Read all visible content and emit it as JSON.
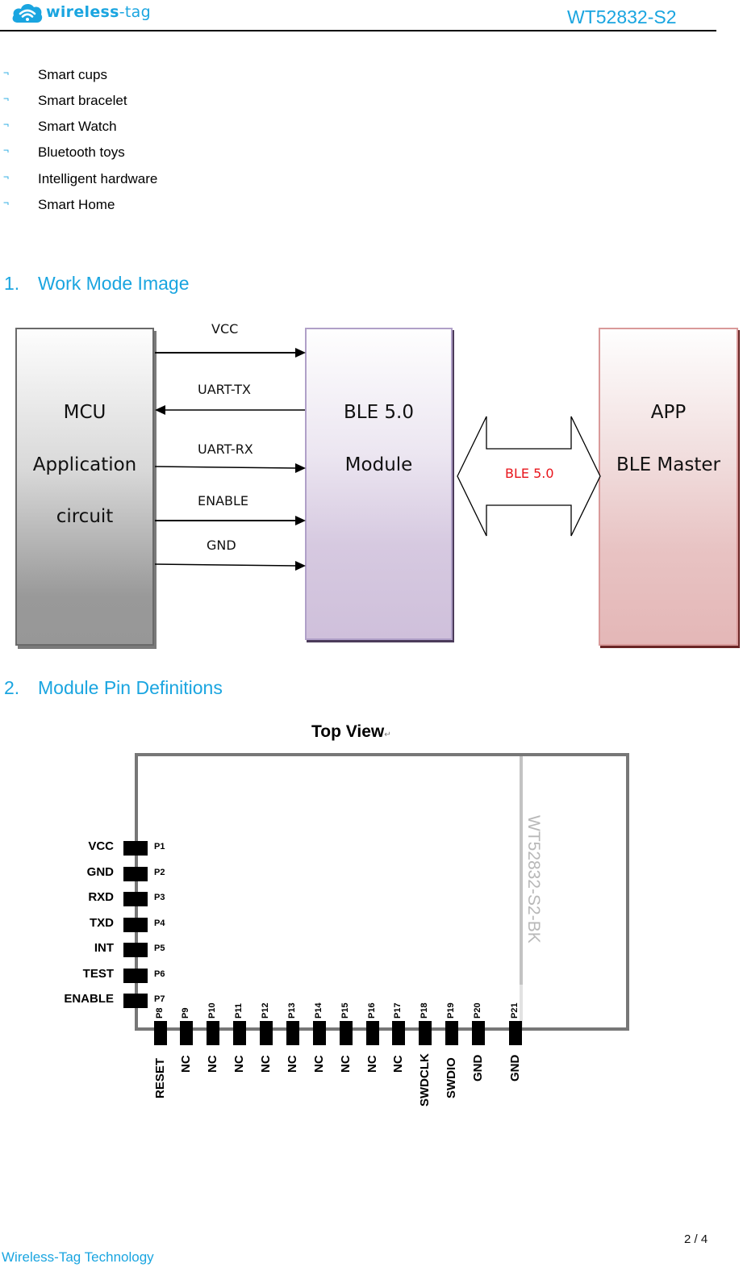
{
  "header": {
    "logo_text_main": "wireless",
    "logo_text_suffix": "-tag",
    "logo_icon": "wifi-cloud-icon",
    "doc_title": "WT52832-S2"
  },
  "applications": {
    "bullet_glyph": "¬",
    "items": [
      "Smart cups",
      "Smart bracelet",
      "Smart Watch",
      "Bluetooth toys",
      "Intelligent hardware",
      "Smart Home"
    ]
  },
  "section1": {
    "number": "1.",
    "title": "Work Mode Image",
    "mcu_box": [
      "MCU",
      "Application",
      "circuit"
    ],
    "ble_box": [
      "BLE 5.0",
      "Module"
    ],
    "app_box": [
      "APP",
      "BLE Master"
    ],
    "signals": [
      {
        "label": "VCC",
        "direction": "to-module"
      },
      {
        "label": "UART-TX",
        "direction": "to-mcu"
      },
      {
        "label": "UART-RX",
        "direction": "to-module"
      },
      {
        "label": "ENABLE",
        "direction": "to-module"
      },
      {
        "label": "GND",
        "direction": "to-module"
      }
    ],
    "link_label": "BLE 5.0",
    "colors": {
      "link_label": "#e8141b",
      "heading": "#1aa5e0"
    }
  },
  "section2": {
    "number": "2.",
    "title": "Module Pin Definitions",
    "view_label": "Top View",
    "return_mark": "↵",
    "module_marking": "WT52832-S2-BK",
    "left_pins": [
      {
        "pin": "P1",
        "name": "VCC"
      },
      {
        "pin": "P2",
        "name": "GND"
      },
      {
        "pin": "P3",
        "name": "RXD"
      },
      {
        "pin": "P4",
        "name": "TXD"
      },
      {
        "pin": "P5",
        "name": "INT"
      },
      {
        "pin": "P6",
        "name": "TEST"
      },
      {
        "pin": "P7",
        "name": "ENABLE"
      }
    ],
    "bottom_pins": [
      {
        "pin": "P8",
        "name": "RESET"
      },
      {
        "pin": "P9",
        "name": "NC"
      },
      {
        "pin": "P10",
        "name": "NC"
      },
      {
        "pin": "P11",
        "name": "NC"
      },
      {
        "pin": "P12",
        "name": "NC"
      },
      {
        "pin": "P13",
        "name": "NC"
      },
      {
        "pin": "P14",
        "name": "NC"
      },
      {
        "pin": "P15",
        "name": "NC"
      },
      {
        "pin": "P16",
        "name": "NC"
      },
      {
        "pin": "P17",
        "name": "NC"
      },
      {
        "pin": "P18",
        "name": "SWDCLK"
      },
      {
        "pin": "P19",
        "name": "SWDIO"
      },
      {
        "pin": "P20",
        "name": "GND"
      },
      {
        "pin": "P21",
        "name": "GND"
      }
    ]
  },
  "footer": {
    "page": "2 / 4",
    "company": "Wireless-Tag Technology"
  }
}
